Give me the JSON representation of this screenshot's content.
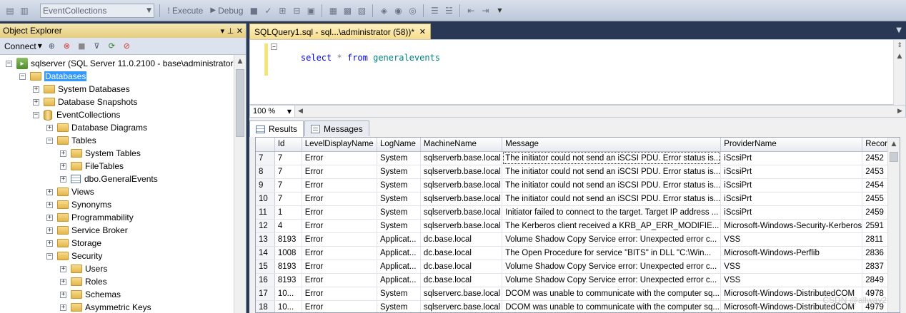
{
  "toolbar": {
    "database": "EventCollections",
    "execute_label": "Execute",
    "debug_label": "Debug"
  },
  "object_explorer": {
    "title": "Object Explorer",
    "pin_glyphs": "▾ ⊥ ✕",
    "connect_label": "Connect",
    "tree": [
      {
        "label": "sqlserver (SQL Server 11.0.2100 - base\\administrator)",
        "kind": "server",
        "level": 0,
        "expander": "−"
      },
      {
        "label": "Databases",
        "kind": "folder",
        "level": 1,
        "expander": "−",
        "selected": true
      },
      {
        "label": "System Databases",
        "kind": "folder",
        "level": 2,
        "expander": "+"
      },
      {
        "label": "Database Snapshots",
        "kind": "folder",
        "level": 2,
        "expander": "+"
      },
      {
        "label": "EventCollections",
        "kind": "database",
        "level": 2,
        "expander": "−"
      },
      {
        "label": "Database Diagrams",
        "kind": "folder",
        "level": 3,
        "expander": "+"
      },
      {
        "label": "Tables",
        "kind": "folder",
        "level": 3,
        "expander": "−"
      },
      {
        "label": "System Tables",
        "kind": "folder",
        "level": 4,
        "expander": "+"
      },
      {
        "label": "FileTables",
        "kind": "folder",
        "level": 4,
        "expander": "+"
      },
      {
        "label": "dbo.GeneralEvents",
        "kind": "table",
        "level": 4,
        "expander": "+"
      },
      {
        "label": "Views",
        "kind": "folder",
        "level": 3,
        "expander": "+"
      },
      {
        "label": "Synonyms",
        "kind": "folder",
        "level": 3,
        "expander": "+"
      },
      {
        "label": "Programmability",
        "kind": "folder",
        "level": 3,
        "expander": "+"
      },
      {
        "label": "Service Broker",
        "kind": "folder",
        "level": 3,
        "expander": "+"
      },
      {
        "label": "Storage",
        "kind": "folder",
        "level": 3,
        "expander": "+"
      },
      {
        "label": "Security",
        "kind": "folder",
        "level": 3,
        "expander": "−"
      },
      {
        "label": "Users",
        "kind": "folder",
        "level": 4,
        "expander": "+"
      },
      {
        "label": "Roles",
        "kind": "folder",
        "level": 4,
        "expander": "+"
      },
      {
        "label": "Schemas",
        "kind": "folder",
        "level": 4,
        "expander": "+"
      },
      {
        "label": "Asymmetric Keys",
        "kind": "folder",
        "level": 4,
        "expander": "+"
      }
    ]
  },
  "editor": {
    "tab_title": "SQLQuery1.sql - sql...\\administrator (58))*",
    "code_select": "select",
    "code_star": "*",
    "code_from": "from",
    "code_table": "generalevents",
    "zoom": "100 %"
  },
  "results": {
    "results_tab": "Results",
    "messages_tab": "Messages",
    "columns": [
      "Id",
      "LevelDisplayName",
      "LogName",
      "MachineName",
      "Message",
      "ProviderName",
      "RecordId"
    ],
    "rows": [
      [
        "7",
        "7",
        "Error",
        "System",
        "sqlserverb.base.local",
        "The initiator could not send an iSCSI PDU. Error status is...",
        "iScsiPrt",
        "2452"
      ],
      [
        "8",
        "7",
        "Error",
        "System",
        "sqlserverb.base.local",
        "The initiator could not send an iSCSI PDU. Error status is...",
        "iScsiPrt",
        "2453"
      ],
      [
        "9",
        "7",
        "Error",
        "System",
        "sqlserverb.base.local",
        "The initiator could not send an iSCSI PDU. Error status is...",
        "iScsiPrt",
        "2454"
      ],
      [
        "10",
        "7",
        "Error",
        "System",
        "sqlserverb.base.local",
        "The initiator could not send an iSCSI PDU. Error status is...",
        "iScsiPrt",
        "2455"
      ],
      [
        "11",
        "1",
        "Error",
        "System",
        "sqlserverb.base.local",
        "Initiator failed to connect to the target. Target IP address ...",
        "iScsiPrt",
        "2459"
      ],
      [
        "12",
        "4",
        "Error",
        "System",
        "sqlserverb.base.local",
        "The Kerberos client received a KRB_AP_ERR_MODIFIE...",
        "Microsoft-Windows-Security-Kerberos",
        "2591"
      ],
      [
        "13",
        "8193",
        "Error",
        "Applicat...",
        "dc.base.local",
        "Volume Shadow Copy Service error: Unexpected error c...",
        "VSS",
        "2811"
      ],
      [
        "14",
        "1008",
        "Error",
        "Applicat...",
        "dc.base.local",
        "The Open Procedure for service \"BITS\" in DLL \"C:\\Win...",
        "Microsoft-Windows-Perflib",
        "2836"
      ],
      [
        "15",
        "8193",
        "Error",
        "Applicat...",
        "dc.base.local",
        "Volume Shadow Copy Service error: Unexpected error c...",
        "VSS",
        "2837"
      ],
      [
        "16",
        "8193",
        "Error",
        "Applicat...",
        "dc.base.local",
        "Volume Shadow Copy Service error: Unexpected error c...",
        "VSS",
        "2849"
      ],
      [
        "17",
        "10...",
        "Error",
        "System",
        "sqlserverc.base.local",
        "DCOM was unable to communicate with the computer sq...",
        "Microsoft-Windows-DistributedCOM",
        "4978"
      ],
      [
        "18",
        "10...",
        "Error",
        "System",
        "sqlserverc.base.local",
        "DCOM was unable to communicate with the computer sq...",
        "Microsoft-Windows-DistributedCOM",
        "4979"
      ]
    ]
  },
  "watermark": "CSDN @allway2"
}
